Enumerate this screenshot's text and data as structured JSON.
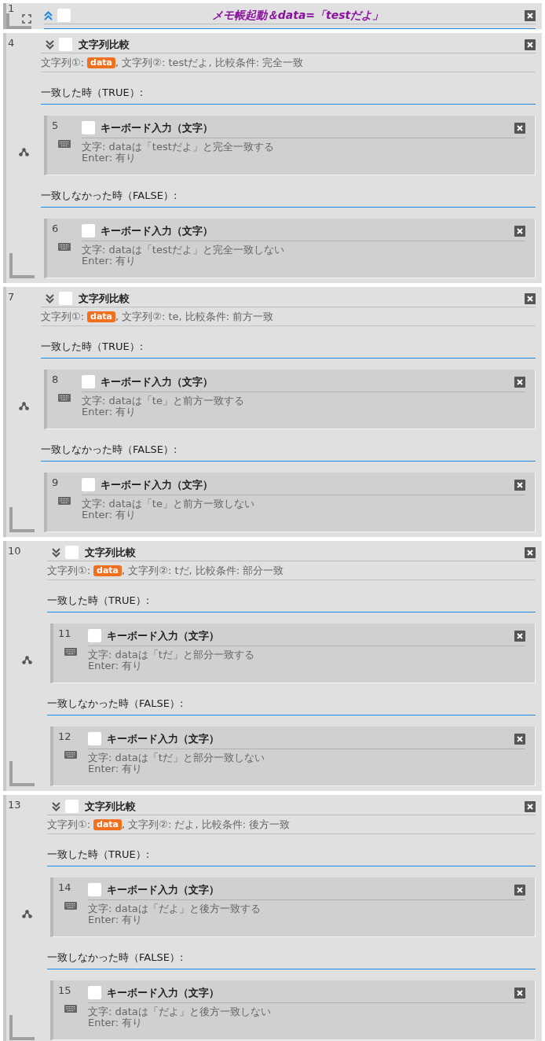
{
  "blocks": [
    {
      "kind": "title",
      "number": "1",
      "checked": false,
      "title": "メモ帳起動＆data=「testだよ」"
    },
    {
      "kind": "compare",
      "number": "4",
      "checked": false,
      "title": "文字列比較",
      "summary": {
        "prefix": "文字列①:",
        "badge": "data",
        "rest": ", 文字列②: testだよ, 比較条件: 完全一致"
      },
      "branches": [
        {
          "label": "一致した時（TRUE）:",
          "step": {
            "number": "5",
            "checked": false,
            "title": "キーボード入力（文字）",
            "lines": [
              "文字: dataは「testだよ」と完全一致する",
              "Enter: 有り"
            ]
          }
        },
        {
          "label": "一致しなかった時（FALSE）:",
          "step": {
            "number": "6",
            "checked": false,
            "title": "キーボード入力（文字）",
            "lines": [
              "文字: dataは「testだよ」と完全一致しない",
              "Enter: 有り"
            ]
          }
        }
      ]
    },
    {
      "kind": "compare",
      "number": "7",
      "checked": false,
      "title": "文字列比較",
      "summary": {
        "prefix": "文字列①:",
        "badge": "data",
        "rest": ", 文字列②: te, 比較条件: 前方一致"
      },
      "branches": [
        {
          "label": "一致した時（TRUE）:",
          "step": {
            "number": "8",
            "checked": false,
            "title": "キーボード入力（文字）",
            "lines": [
              "文字: dataは「te」と前方一致する",
              "Enter: 有り"
            ]
          }
        },
        {
          "label": "一致しなかった時（FALSE）:",
          "step": {
            "number": "9",
            "checked": false,
            "title": "キーボード入力（文字）",
            "lines": [
              "文字: dataは「te」と前方一致しない",
              "Enter: 有り"
            ]
          }
        }
      ]
    },
    {
      "kind": "compare",
      "number": "10",
      "checked": false,
      "title": "文字列比較",
      "summary": {
        "prefix": "文字列①:",
        "badge": "data",
        "rest": ", 文字列②: tだ, 比較条件: 部分一致"
      },
      "branches": [
        {
          "label": "一致した時（TRUE）:",
          "step": {
            "number": "11",
            "checked": false,
            "title": "キーボード入力（文字）",
            "lines": [
              "文字: dataは「tだ」と部分一致する",
              "Enter: 有り"
            ]
          }
        },
        {
          "label": "一致しなかった時（FALSE）:",
          "step": {
            "number": "12",
            "checked": false,
            "title": "キーボード入力（文字）",
            "lines": [
              "文字: dataは「tだ」と部分一致しない",
              "Enter: 有り"
            ]
          }
        }
      ]
    },
    {
      "kind": "compare",
      "number": "13",
      "checked": false,
      "title": "文字列比較",
      "summary": {
        "prefix": "文字列①:",
        "badge": "data",
        "rest": ", 文字列②: だよ, 比較条件: 後方一致"
      },
      "branches": [
        {
          "label": "一致した時（TRUE）:",
          "step": {
            "number": "14",
            "checked": false,
            "title": "キーボード入力（文字）",
            "lines": [
              "文字: dataは「だよ」と後方一致する",
              "Enter: 有り"
            ]
          }
        },
        {
          "label": "一致しなかった時（FALSE）:",
          "step": {
            "number": "15",
            "checked": false,
            "title": "キーボード入力（文字）",
            "lines": [
              "文字: dataは「だよ」と後方一致しない",
              "Enter: 有り"
            ]
          }
        }
      ]
    }
  ]
}
